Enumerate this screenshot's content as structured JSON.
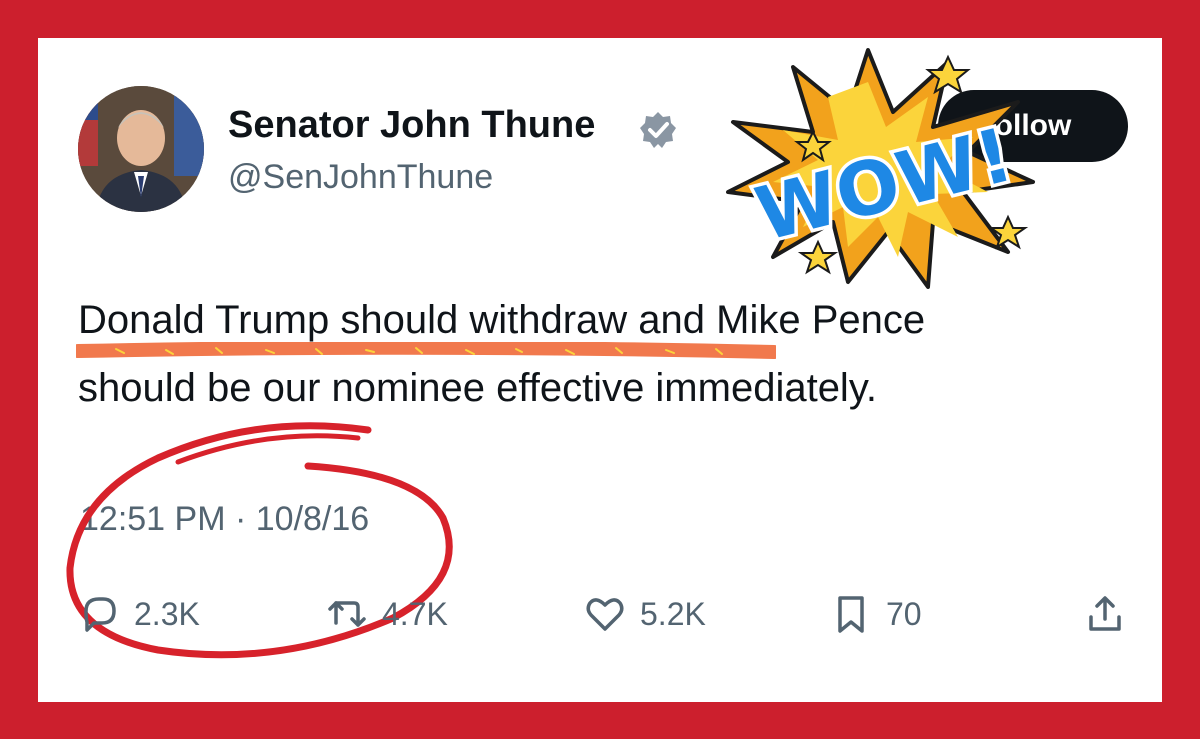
{
  "tweet": {
    "author": {
      "display_name": "Senator John Thune",
      "handle": "@SenJohnThune"
    },
    "follow_label": "ollow",
    "text_line_1": "Donald Trump should withdraw and Mike Pence",
    "text_line_2": "should be our nominee effective immediately.",
    "timestamp": "12:51 PM · 10/8/16",
    "metrics": {
      "replies": "2.3K",
      "reposts": "4.7K",
      "likes": "5.2K",
      "bookmarks": "70"
    }
  },
  "sticker": {
    "text": "WOW!"
  },
  "colors": {
    "frame": "#cc1f2d",
    "card": "#ffffff",
    "text_primary": "#0f1419",
    "text_secondary": "#536471",
    "verified": "#8a96a3",
    "highlight": "#f06a3a",
    "annotation_circle": "#d7222b",
    "sticker_burst": "#f2a21c",
    "sticker_text": "#1e88e5"
  },
  "icons": [
    "verified-badge-icon",
    "reply-icon",
    "repost-icon",
    "like-icon",
    "bookmark-icon",
    "share-icon"
  ]
}
